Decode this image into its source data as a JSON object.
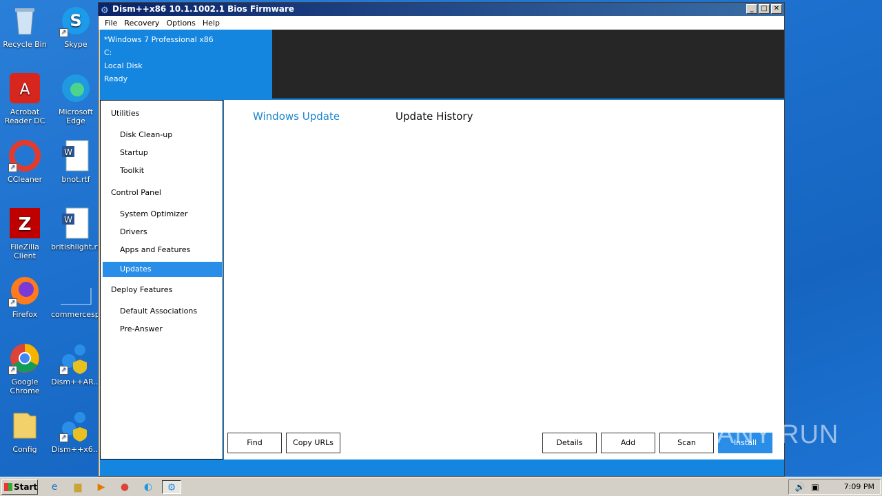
{
  "desktop": {
    "icons": [
      {
        "label": "Recycle Bin",
        "icon": "recycle-bin-icon"
      },
      {
        "label": "Skype",
        "icon": "skype-icon"
      },
      {
        "label": "Acrobat Reader DC",
        "icon": "acrobat-icon"
      },
      {
        "label": "Microsoft Edge",
        "icon": "edge-icon"
      },
      {
        "label": "CCleaner",
        "icon": "ccleaner-icon"
      },
      {
        "label": "bnot.rtf",
        "icon": "word-doc-icon"
      },
      {
        "label": "FileZilla Client",
        "icon": "filezilla-icon"
      },
      {
        "label": "britishlight.rtf",
        "icon": "word-doc-icon"
      },
      {
        "label": "Firefox",
        "icon": "firefox-icon"
      },
      {
        "label": "commercesp...",
        "icon": "blank-file-icon"
      },
      {
        "label": "Google Chrome",
        "icon": "chrome-icon"
      },
      {
        "label": "Dism++AR...",
        "icon": "dism-icon"
      },
      {
        "label": "Config",
        "icon": "folder-icon"
      },
      {
        "label": "Dism++x6...",
        "icon": "dism-icon"
      }
    ]
  },
  "window": {
    "title": "Dism++x86 10.1.1002.1 Bios Firmware",
    "menu": [
      "File",
      "Recovery",
      "Options",
      "Help"
    ],
    "system_info": [
      "*Windows 7 Professional x86",
      "C:",
      "Local Disk",
      "Ready"
    ],
    "sidebar": {
      "utilities": "Utilities",
      "disk_cleanup": "Disk Clean-up",
      "startup": "Startup",
      "toolkit": "Toolkit",
      "control_panel": "Control Panel",
      "system_optimizer": "System Optimizer",
      "drivers": "Drivers",
      "apps_features": "Apps and Features",
      "updates": "Updates",
      "deploy_features": "Deploy Features",
      "default_associations": "Default Associations",
      "pre_answer": "Pre-Answer"
    },
    "tabs": {
      "windows_update": "Windows Update",
      "update_history": "Update History"
    },
    "buttons": {
      "find": "Find",
      "copy_urls": "Copy URLs",
      "details": "Details",
      "add": "Add",
      "scan": "Scan",
      "install_updates": "Install Updates"
    }
  },
  "taskbar": {
    "start": "Start",
    "clock": "7:09 PM"
  },
  "watermark": "ANY RUN"
}
